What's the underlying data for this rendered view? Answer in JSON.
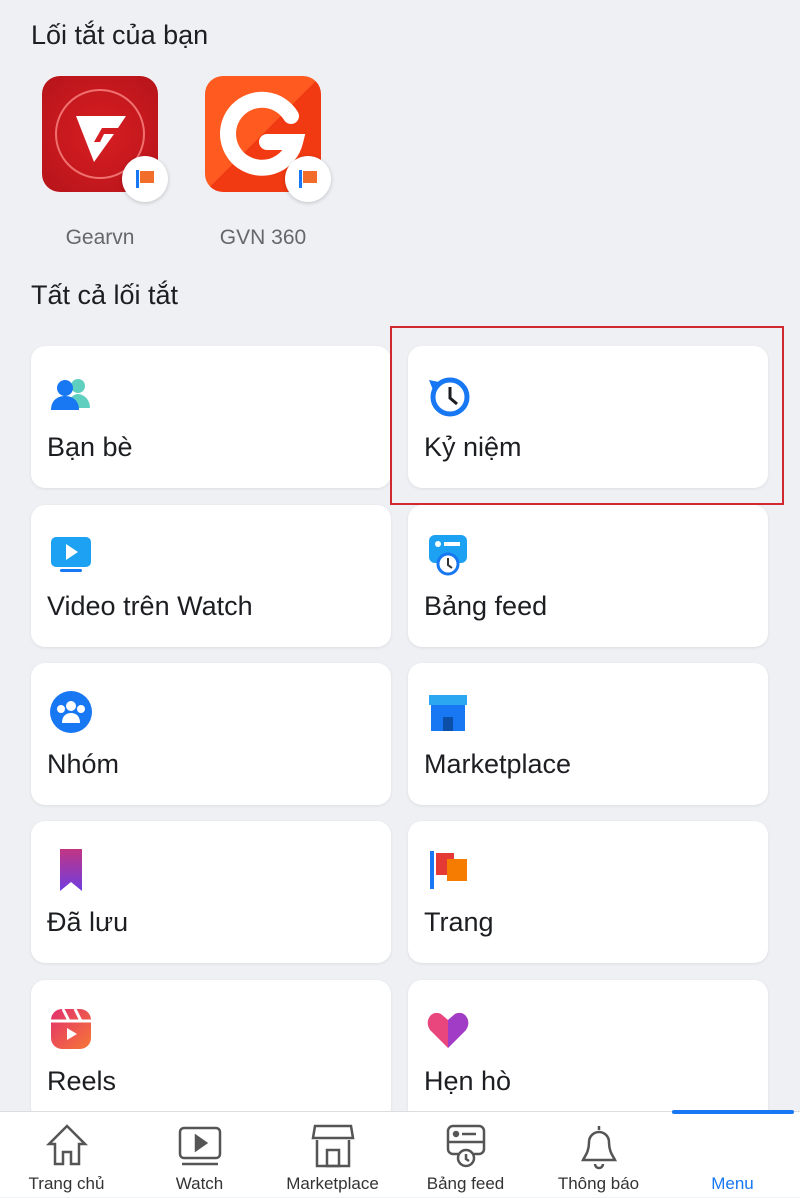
{
  "your_shortcuts": {
    "title": "Lối tắt của bạn",
    "items": [
      {
        "label": "Gearvn"
      },
      {
        "label": "GVN 360"
      }
    ]
  },
  "all_shortcuts": {
    "title": "Tất cả lối tắt",
    "items": [
      {
        "label": "Bạn bè",
        "icon": "friends-icon"
      },
      {
        "label": "Kỷ niệm",
        "icon": "memories-clock-icon",
        "highlighted": true
      },
      {
        "label": "Video trên Watch",
        "icon": "watch-video-icon"
      },
      {
        "label": "Bảng feed",
        "icon": "feed-icon"
      },
      {
        "label": "Nhóm",
        "icon": "groups-icon"
      },
      {
        "label": "Marketplace",
        "icon": "marketplace-icon"
      },
      {
        "label": "Đã lưu",
        "icon": "saved-bookmark-icon"
      },
      {
        "label": "Trang",
        "icon": "pages-flag-icon"
      },
      {
        "label": "Reels",
        "icon": "reels-icon"
      },
      {
        "label": "Hẹn hò",
        "icon": "dating-heart-icon"
      }
    ]
  },
  "bottom_nav": [
    {
      "label": "Trang chủ"
    },
    {
      "label": "Watch"
    },
    {
      "label": "Marketplace"
    },
    {
      "label": "Bảng feed"
    },
    {
      "label": "Thông báo"
    },
    {
      "label": "Menu",
      "active": true
    }
  ],
  "colors": {
    "accent": "#1877f2",
    "highlight": "#d0282e"
  }
}
